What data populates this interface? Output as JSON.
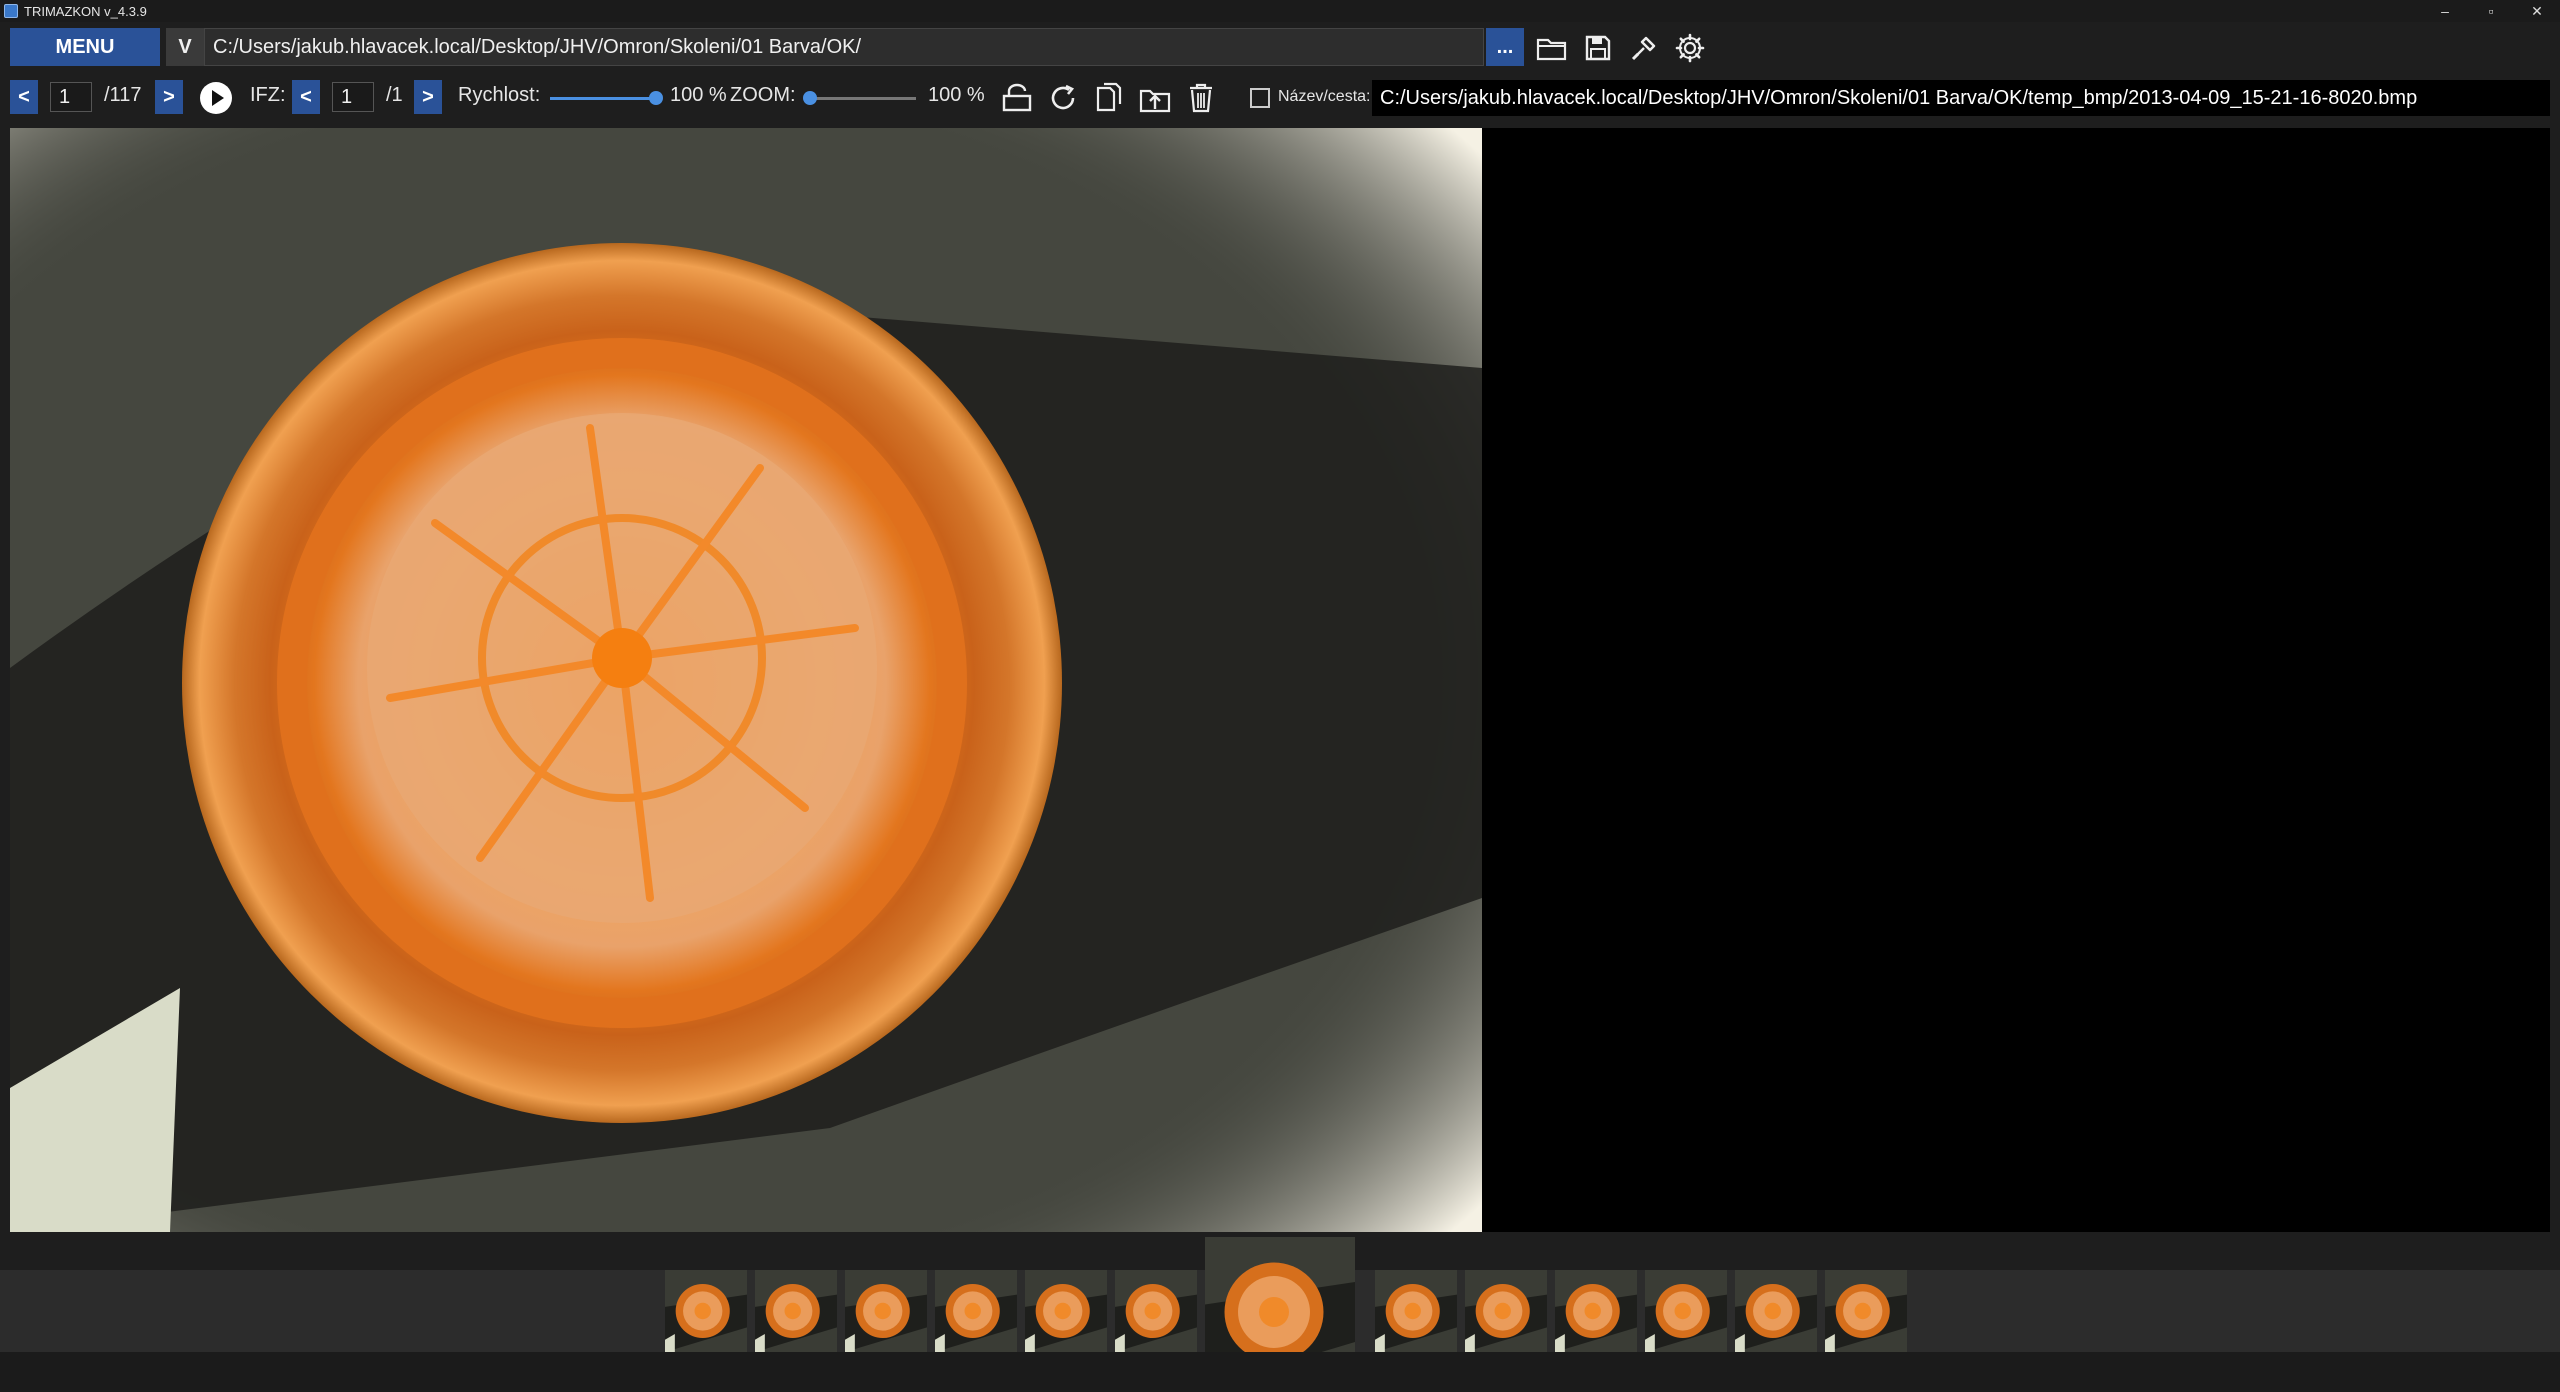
{
  "window": {
    "title": "TRIMAZKON v_4.3.9",
    "controls": [
      "–",
      "▫",
      "✕"
    ]
  },
  "toolbar_top": {
    "menu_label": "MENU",
    "view_label": "V",
    "path_value": "C:/Users/jakub.hlavacek.local/Desktop/JHV/Omron/Skoleni/01 Barva/OK/",
    "browse_label": "...",
    "icons": [
      "folder-open-icon",
      "save-icon",
      "tool-icon",
      "gear-icon"
    ]
  },
  "toolbar_nav": {
    "prev_label": "<",
    "next_label": ">",
    "current_index": "1",
    "total": "/117",
    "ifz_label": "IFZ:",
    "ifz_prev_label": "<",
    "ifz_next_label": ">",
    "ifz_current": "1",
    "ifz_total": "/1",
    "speed_label": "Rychlost:",
    "speed_value_text": "100 %",
    "speed_level": 1.0,
    "zoom_label": "ZOOM:",
    "zoom_value_text": "100 %",
    "zoom_level": 0.0,
    "icons": [
      "unlock-icon",
      "rotate-icon",
      "copy-icon",
      "move-icon",
      "trash-icon"
    ],
    "name_path_checkbox_label": "Název/cesta:",
    "name_path_checked": false,
    "file_path": "C:/Users/jakub.hlavacek.local/Desktop/JHV/Omron/Skoleni/01 Barva/OK/temp_bmp/2013-04-09_15-21-16-8020.bmp"
  },
  "thumbnails": {
    "before_count": 6,
    "after_count": 6
  },
  "colors": {
    "accent": "#2a5298",
    "background": "#1e1e1e",
    "part_orange": "#f08a2a"
  }
}
